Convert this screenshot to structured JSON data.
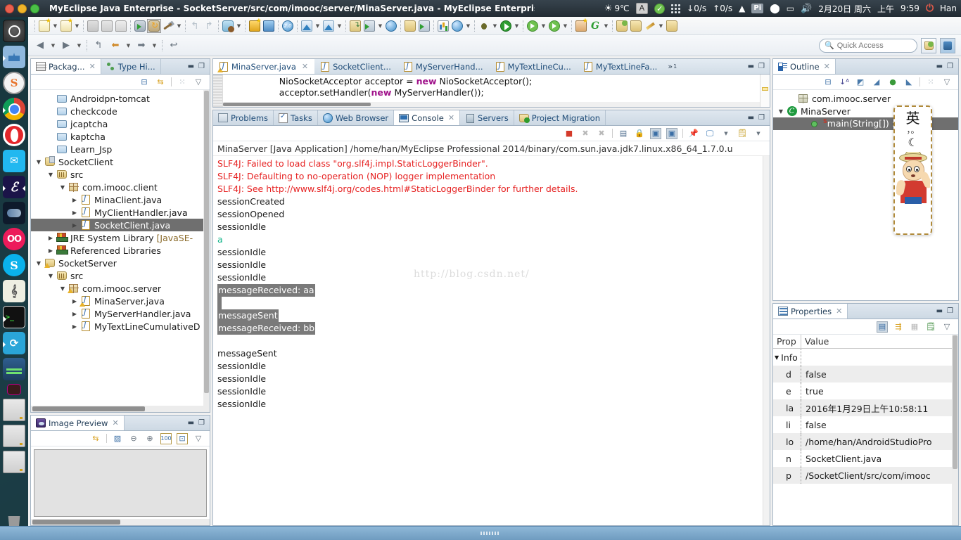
{
  "window": {
    "title": "MyEclipse Java Enterprise - SocketServer/src/com/imooc/server/MinaServer.java - MyEclipse Enterprise Workbench"
  },
  "tray": {
    "temperature": "9℃",
    "keyboard_layout": "A",
    "download_speed": "↓0/s",
    "upload_speed": "↑0/s",
    "pi_label": "Pi",
    "date": "2月20日 周六",
    "period": "上午",
    "time": "9:59",
    "user": "Han"
  },
  "launcher": {
    "items": [
      {
        "name": "ubuntu-dash",
        "label": "Dash"
      },
      {
        "name": "files",
        "label": "Files"
      },
      {
        "name": "sublime",
        "label": "S"
      },
      {
        "name": "chrome",
        "label": "Chrome"
      },
      {
        "name": "opera",
        "label": "Opera"
      },
      {
        "name": "wechat",
        "label": "WeChat"
      },
      {
        "name": "eclipse",
        "label": "Eclipse"
      },
      {
        "name": "steam",
        "label": "Steam"
      },
      {
        "name": "oo",
        "label": "OO"
      },
      {
        "name": "skype",
        "label": "Skype"
      },
      {
        "name": "music",
        "label": "Music"
      },
      {
        "name": "terminal",
        "label": "Terminal"
      },
      {
        "name": "sync",
        "label": "Sync"
      },
      {
        "name": "ide",
        "label": "IDE"
      },
      {
        "name": "mini",
        "label": "Mini"
      },
      {
        "name": "window1",
        "label": "Window"
      },
      {
        "name": "window2",
        "label": "Window"
      },
      {
        "name": "window3",
        "label": "Window"
      },
      {
        "name": "trash",
        "label": "Trash"
      }
    ]
  },
  "toolbar2": {
    "quick_access_placeholder": "Quick Access",
    "quick_access_value": ""
  },
  "package_explorer": {
    "tabs": [
      {
        "label": "Packag...",
        "icon": "package-explorer-icon",
        "active": true,
        "closeable": true
      },
      {
        "label": "Type Hi...",
        "icon": "type-hierarchy-icon",
        "active": false,
        "closeable": false
      }
    ],
    "tree": [
      {
        "indent": 1,
        "arrow": "",
        "icon": "folder",
        "label": "Androidpn-tomcat"
      },
      {
        "indent": 1,
        "arrow": "",
        "icon": "folder",
        "label": "checkcode"
      },
      {
        "indent": 1,
        "arrow": "",
        "icon": "folder",
        "label": "jcaptcha"
      },
      {
        "indent": 1,
        "arrow": "",
        "icon": "folder",
        "label": "kaptcha"
      },
      {
        "indent": 1,
        "arrow": "",
        "icon": "folder",
        "label": "Learn_Jsp"
      },
      {
        "indent": 0,
        "arrow": "open",
        "icon": "project",
        "label": "SocketClient"
      },
      {
        "indent": 1,
        "arrow": "open",
        "icon": "src",
        "label": "src"
      },
      {
        "indent": 2,
        "arrow": "open",
        "icon": "package",
        "label": "com.imooc.client"
      },
      {
        "indent": 3,
        "arrow": "closed",
        "icon": "java",
        "label": "MinaClient.java"
      },
      {
        "indent": 3,
        "arrow": "closed",
        "icon": "java",
        "label": "MyClientHandler.java"
      },
      {
        "indent": 3,
        "arrow": "closed",
        "icon": "java",
        "label": "SocketClient.java",
        "selected": true
      },
      {
        "indent": 1,
        "arrow": "closed",
        "icon": "library",
        "label": "JRE System Library ",
        "dim": "[JavaSE-"
      },
      {
        "indent": 1,
        "arrow": "closed",
        "icon": "library",
        "label": "Referenced Libraries"
      },
      {
        "indent": 0,
        "arrow": "open",
        "icon": "project-warn",
        "label": "SocketServer"
      },
      {
        "indent": 1,
        "arrow": "open",
        "icon": "src",
        "label": "src"
      },
      {
        "indent": 2,
        "arrow": "open",
        "icon": "package-warn",
        "label": "com.imooc.server"
      },
      {
        "indent": 3,
        "arrow": "closed",
        "icon": "java-warn",
        "label": "MinaServer.java"
      },
      {
        "indent": 3,
        "arrow": "closed",
        "icon": "java",
        "label": "MyServerHandler.java"
      },
      {
        "indent": 3,
        "arrow": "closed",
        "icon": "java",
        "label": "MyTextLineCumulativeD"
      }
    ]
  },
  "image_preview": {
    "tab_label": "Image Preview",
    "toolbar_icons": [
      "link-with-editor-icon",
      "preview-image-icon",
      "zoom-out-icon",
      "zoom-in-icon",
      "zoom-100-icon",
      "fit-image-icon",
      "view-menu-icon"
    ]
  },
  "editor": {
    "tabs": [
      {
        "label": "MinaServer.java",
        "active": true,
        "warn": true,
        "closeable": true
      },
      {
        "label": "SocketClient...",
        "active": false,
        "warn": false,
        "closeable": false
      },
      {
        "label": "MyServerHand...",
        "active": false,
        "warn": false,
        "closeable": false
      },
      {
        "label": "MyTextLineCu...",
        "active": false,
        "warn": false,
        "closeable": false
      },
      {
        "label": "MyTextLineFa...",
        "active": false,
        "warn": false,
        "closeable": false
      }
    ],
    "overflow_badge": "1",
    "code_lines": [
      {
        "segments": [
          {
            "t": "        NioSocketAcceptor acceptor = ",
            "k": false
          },
          {
            "t": "new",
            "k": true
          },
          {
            "t": " NioSocketAcceptor();",
            "k": false
          }
        ]
      },
      {
        "segments": [
          {
            "t": "        acceptor.setHandler(",
            "k": false
          },
          {
            "t": "new",
            "k": true
          },
          {
            "t": " MyServerHandler());",
            "k": false
          }
        ]
      }
    ]
  },
  "console_panel": {
    "tabs": [
      {
        "label": "Problems",
        "icon": "problems-icon",
        "active": false
      },
      {
        "label": "Tasks",
        "icon": "tasks-icon",
        "active": false
      },
      {
        "label": "Web Browser",
        "icon": "web-browser-icon",
        "active": false
      },
      {
        "label": "Console",
        "icon": "console-icon",
        "active": true,
        "closeable": true
      },
      {
        "label": "Servers",
        "icon": "servers-icon",
        "active": false
      },
      {
        "label": "Project Migration",
        "icon": "project-migration-icon",
        "active": false
      }
    ],
    "toolbar_icons": [
      "terminate-icon",
      "remove-launch-icon",
      "remove-all-launches-icon",
      "clear-console-icon",
      "scroll-lock-icon",
      "show-console-on-output-icon",
      "show-console-on-error-icon",
      "pin-console-icon",
      "display-selected-console-icon",
      "display-selected-console-menu-icon",
      "open-console-icon",
      "open-console-menu-icon"
    ],
    "launch_header": "MinaServer [Java Application] /home/han/MyEclipse Professional 2014/binary/com.sun.java.jdk7.linux.x86_64_1.7.0.u",
    "watermark": "http://blog.csdn.net/",
    "lines": [
      {
        "text": "SLF4J: Failed to load class \"org.slf4j.impl.StaticLoggerBinder\".",
        "style": "err"
      },
      {
        "text": "SLF4J: Defaulting to no-operation (NOP) logger implementation",
        "style": "err"
      },
      {
        "text": "SLF4J: See http://www.slf4j.org/codes.html#StaticLoggerBinder for further details.",
        "style": "err"
      },
      {
        "text": "sessionCreated",
        "style": "normal"
      },
      {
        "text": "sessionOpened",
        "style": "normal"
      },
      {
        "text": "sessionIdle",
        "style": "normal"
      },
      {
        "text": "a",
        "style": "grn"
      },
      {
        "text": "sessionIdle",
        "style": "normal"
      },
      {
        "text": "sessionIdle",
        "style": "normal"
      },
      {
        "text": "sessionIdle",
        "style": "normal"
      },
      {
        "text": "messageReceived: aa",
        "style": "hl"
      },
      {
        "text": " ",
        "style": "hl"
      },
      {
        "text": "messageSent",
        "style": "hl"
      },
      {
        "text": "messageReceived: bb",
        "style": "hl"
      },
      {
        "text": "",
        "style": "normal"
      },
      {
        "text": "messageSent",
        "style": "normal"
      },
      {
        "text": "sessionIdle",
        "style": "normal"
      },
      {
        "text": "sessionIdle",
        "style": "normal"
      },
      {
        "text": "sessionIdle",
        "style": "normal"
      },
      {
        "text": "sessionIdle",
        "style": "normal"
      }
    ]
  },
  "outline": {
    "tab_label": "Outline",
    "toolbar_icons": [
      "collapse-all-icon",
      "sort-icon",
      "hide-fields-icon",
      "hide-static-icon",
      "hide-nonpublic-icon",
      "hide-local-types-icon",
      "view-menu-icon"
    ],
    "items": [
      {
        "indent": 1,
        "arrow": "",
        "icon": "package",
        "label": "com.imooc.server"
      },
      {
        "indent": 0,
        "arrow": "open",
        "icon": "class",
        "label": "MinaServer"
      },
      {
        "indent": 2,
        "arrow": "",
        "icon": "method",
        "label": "main(String[]) : v",
        "selected": true,
        "sup": "S"
      }
    ]
  },
  "properties": {
    "tab_label": "Properties",
    "toolbar_icons": [
      "show-categories-icon",
      "show-advanced-icon",
      "restore-default-icon",
      "new-property-icon",
      "view-menu-icon"
    ],
    "columns": [
      "Prop",
      "Value"
    ],
    "rows": [
      {
        "name": "Info",
        "value": "",
        "group": true
      },
      {
        "name": "d",
        "value": "false"
      },
      {
        "name": "e",
        "value": "true"
      },
      {
        "name": "la",
        "value": "2016年1月29日上午10:58:11"
      },
      {
        "name": "li",
        "value": "false"
      },
      {
        "name": "lo",
        "value": "/home/han/AndroidStudioPro"
      },
      {
        "name": "n",
        "value": "SocketClient.java"
      },
      {
        "name": "p",
        "value": "/SocketClient/src/com/imooc"
      }
    ]
  },
  "ime": {
    "mode": "英",
    "punctuation": "，。",
    "moon_icon": "moon-icon",
    "avatar": "luffy-avatar"
  }
}
